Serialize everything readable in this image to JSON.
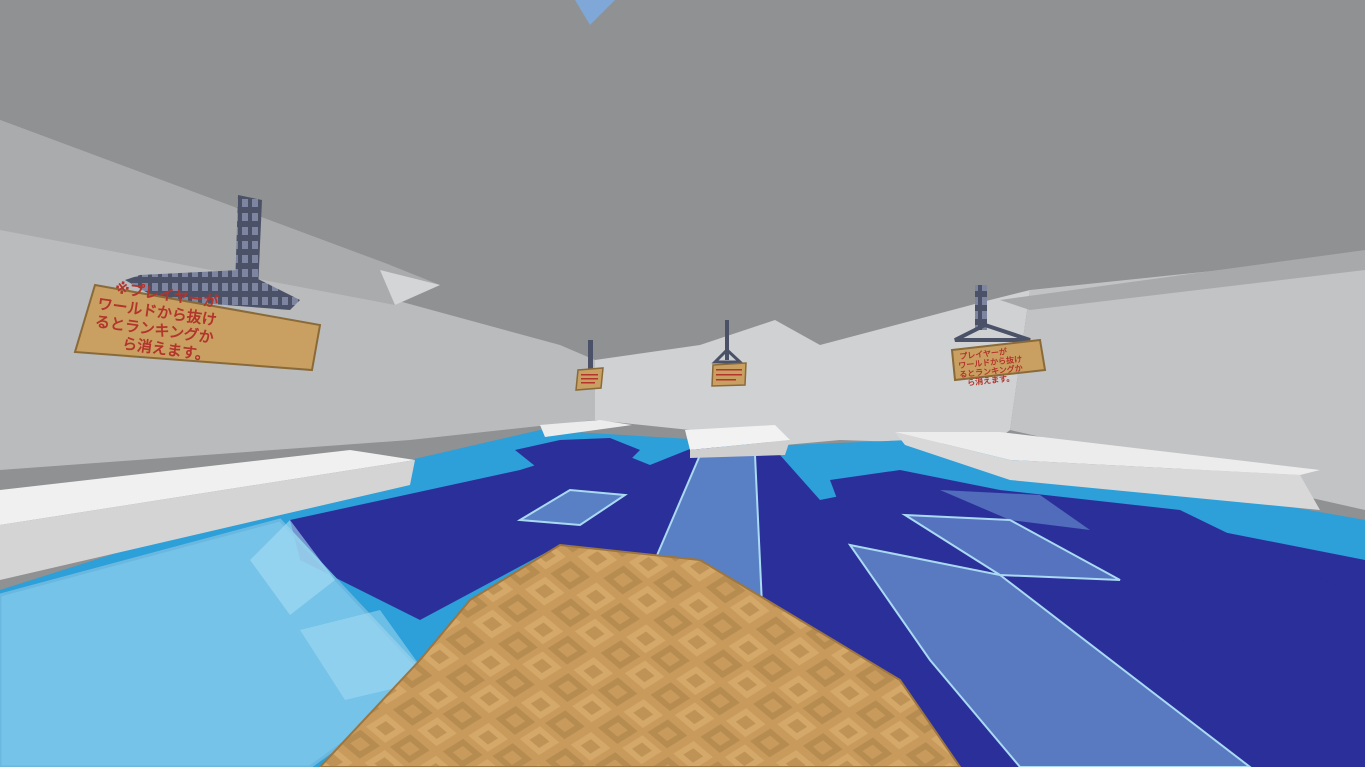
{
  "scene": {
    "colors": {
      "ceiling": "#8f9192",
      "wall_light": "#cbcdcf",
      "wall_mid": "#b7b9bb",
      "floor_light_blue": "#2d9fd9",
      "floor_dark_blue": "#2b2f9a",
      "glass": "#9fd3ec",
      "planks": "#c89a5c",
      "quartz": "#e6e6e6",
      "sign_wood": "#c9a062",
      "sign_text": "#b3342a",
      "chain": "#4b5268"
    }
  },
  "signs": [
    {
      "lines": [
        "※プレイヤーが",
        "ワールドから抜け",
        "るとランキングか",
        "ら消えます。"
      ]
    },
    {
      "lines": []
    },
    {
      "lines": []
    },
    {
      "lines": [
        "プレイヤーが",
        "ワールドから抜け",
        "るとランキングか",
        "ら消えます。"
      ]
    }
  ]
}
